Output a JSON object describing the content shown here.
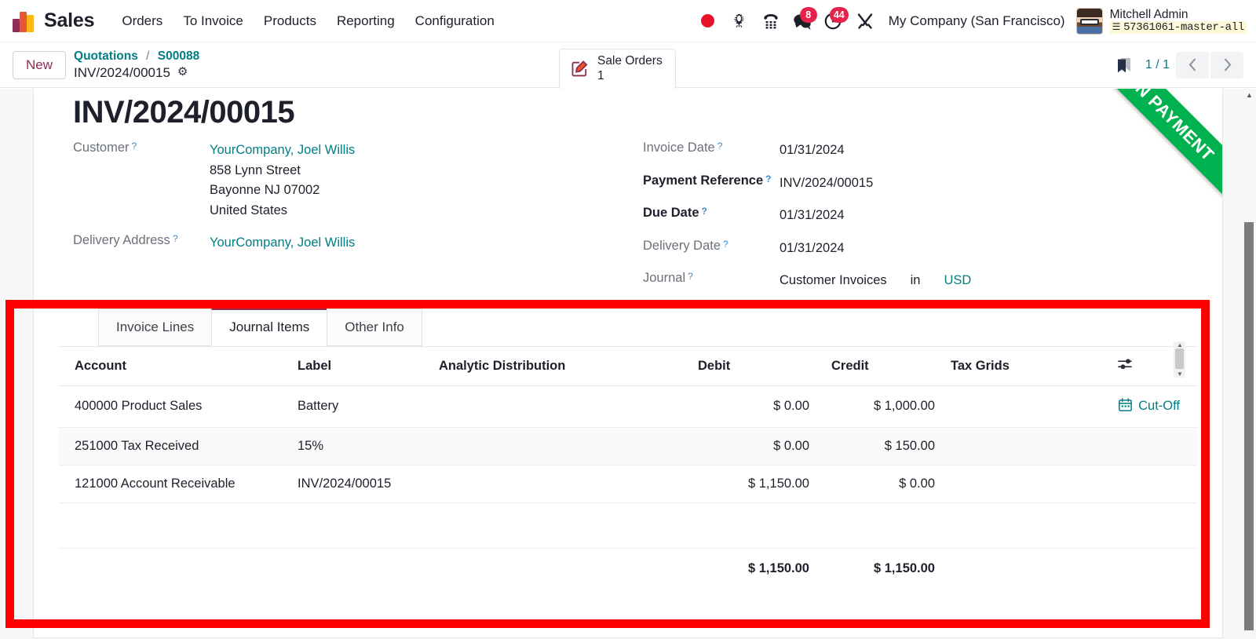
{
  "navbar": {
    "brand": "Sales",
    "menus": [
      "Orders",
      "To Invoice",
      "Products",
      "Reporting",
      "Configuration"
    ],
    "icons": [
      {
        "name": "recording-dot-icon",
        "badge": null
      },
      {
        "name": "bug-icon",
        "badge": null
      },
      {
        "name": "phone-dialpad-icon",
        "badge": null
      },
      {
        "name": "messages-icon",
        "badge": "8"
      },
      {
        "name": "activities-clock-icon",
        "badge": "44"
      },
      {
        "name": "tools-wrench-icon",
        "badge": null
      }
    ],
    "company": "My Company (San Francisco)",
    "user_name": "Mitchell Admin",
    "user_db": "57361061-master-all",
    "db_icon": "database-icon"
  },
  "control_panel": {
    "new_label": "New",
    "breadcrumb": {
      "root": "Quotations",
      "separator": "/",
      "parent": "S00088",
      "current": "INV/2024/00015",
      "gear_icon": "gear-icon"
    },
    "smart_button": {
      "label": "Sale Orders",
      "count": "1",
      "icon": "edit-square-icon"
    },
    "bookmark_icon": "bookmark-icon",
    "pager": {
      "text": "1 / 1",
      "prev_icon": "chevron-left-icon",
      "next_icon": "chevron-right-icon"
    }
  },
  "document": {
    "ribbon": "IN PAYMENT",
    "title": "INV/2024/00015",
    "left_fields": [
      {
        "label": "Customer",
        "help": "?",
        "bold": false,
        "value": "YourCompany, Joel Willis",
        "link": true,
        "address": [
          "858 Lynn Street",
          "Bayonne NJ 07002",
          "United States"
        ]
      },
      {
        "label": "Delivery Address",
        "help": "?",
        "bold": false,
        "value": "YourCompany, Joel Willis",
        "link": true,
        "address": []
      }
    ],
    "right_fields": [
      {
        "label": "Invoice Date",
        "help": "?",
        "bold": false,
        "value": "01/31/2024"
      },
      {
        "label": "Payment Reference",
        "help": "?",
        "bold": true,
        "value": "INV/2024/00015"
      },
      {
        "label": "Due Date",
        "help": "?",
        "bold": true,
        "value": "01/31/2024"
      },
      {
        "label": "Delivery Date",
        "help": "?",
        "bold": false,
        "value": "01/31/2024"
      }
    ],
    "journal": {
      "label": "Journal",
      "help": "?",
      "value": "Customer Invoices",
      "in_word": "in",
      "currency": "USD"
    }
  },
  "notebook": {
    "tabs": [
      {
        "label": "Invoice Lines",
        "active": false
      },
      {
        "label": "Journal Items",
        "active": true
      },
      {
        "label": "Other Info",
        "active": false
      }
    ],
    "optional_columns_icon": "column-options-icon"
  },
  "journal_items": {
    "columns": [
      "Account",
      "Label",
      "Analytic Distribution",
      "Debit",
      "Credit",
      "Tax Grids"
    ],
    "rows": [
      {
        "account": "400000 Product Sales",
        "label": "Battery",
        "analytic": "",
        "debit": "$ 0.00",
        "credit": "$ 1,000.00",
        "tax_grids": "",
        "cutoff": "Cut-Off",
        "cutoff_icon": "calendar-icon"
      },
      {
        "account": "251000 Tax Received",
        "label": "15%",
        "analytic": "",
        "debit": "$ 0.00",
        "credit": "$ 150.00",
        "tax_grids": "",
        "cutoff": "",
        "cutoff_icon": ""
      },
      {
        "account": "121000 Account Receivable",
        "label": "INV/2024/00015",
        "analytic": "",
        "debit": "$ 1,150.00",
        "credit": "$ 0.00",
        "tax_grids": "",
        "cutoff": "",
        "cutoff_icon": ""
      }
    ],
    "totals": {
      "debit": "$ 1,150.00",
      "credit": "$ 1,150.00"
    }
  },
  "colors": {
    "highlight": "#ff0000",
    "ribbon_green": "#00b14f",
    "link_teal": "#017e84",
    "accent_purple": "#8f2d56",
    "badge_red": "#e4224a"
  }
}
